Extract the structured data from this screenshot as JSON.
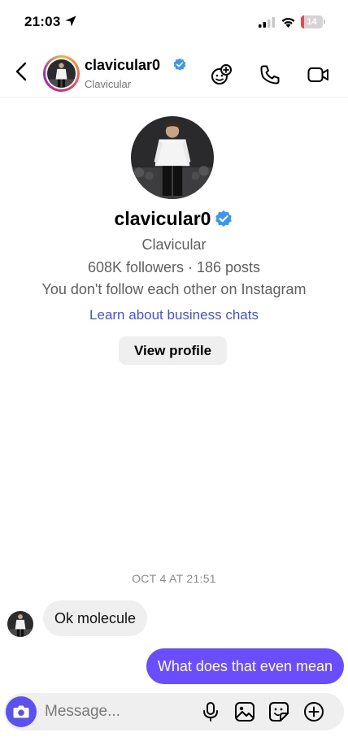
{
  "status": {
    "time": "21:03",
    "battery": "14",
    "battery_level": 0.14
  },
  "header": {
    "username": "clavicular0",
    "subtitle": "Clavicular",
    "icons": [
      "back-chevron-icon",
      "add-effect-icon",
      "phone-icon",
      "video-icon"
    ]
  },
  "profile": {
    "username": "clavicular0",
    "full_name": "Clavicular",
    "stats": "608K followers · 186 posts",
    "follow_status": "You don't follow each other on Instagram",
    "learn_link": "Learn about business chats",
    "view_profile_label": "View profile"
  },
  "thread": {
    "timestamp": "OCT 4 AT 21:51",
    "messages": [
      {
        "direction": "incoming",
        "text": "Ok molecule"
      },
      {
        "direction": "outgoing",
        "text": "What does that even mean"
      }
    ]
  },
  "composer": {
    "placeholder": "Message...",
    "icons": [
      "camera-icon",
      "microphone-icon",
      "gallery-icon",
      "sticker-icon",
      "plus-icon"
    ]
  },
  "colors": {
    "accent": "#4150f7",
    "outgoing_bubble": "#6a4dfd",
    "camera_button": "#5b51f3",
    "verified": "#3897f0",
    "battery_low": "#e8494e"
  }
}
